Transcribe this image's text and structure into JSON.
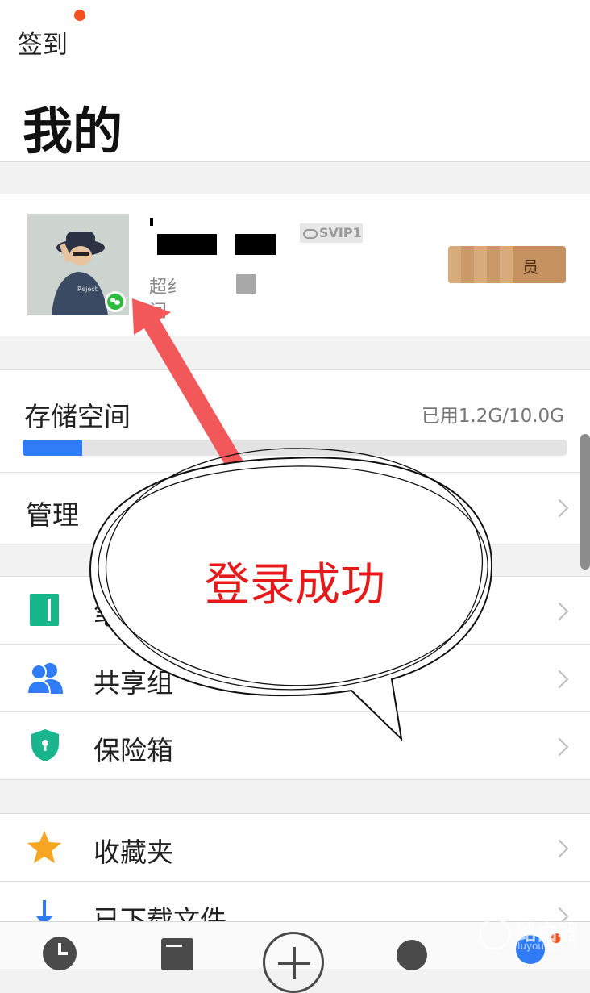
{
  "header": {
    "checkin_label": "签到",
    "title": "我的"
  },
  "profile": {
    "name_redacted": "",
    "vip_badge": "SVIP1",
    "member_button": "员",
    "sub_line1": "超纟",
    "sub_line2": "间"
  },
  "storage": {
    "title": "存储空间",
    "usage": "已用1.2G/10.0G",
    "used_fraction": 0.11,
    "manage_label": "管理"
  },
  "menu1": [
    {
      "label": "笔",
      "icon": "notebook-icon"
    },
    {
      "label": "共享组",
      "icon": "people-icon"
    },
    {
      "label": "保险箱",
      "icon": "shield-icon"
    }
  ],
  "menu2": [
    {
      "label": "收藏夹",
      "icon": "star-icon"
    },
    {
      "label": "已下载文件",
      "icon": "download-arrow-icon"
    }
  ],
  "annotation": {
    "bubble_text": "登录成功"
  },
  "watermark": {
    "text": "路由器",
    "subtext": "luyouqi.com"
  },
  "colors": {
    "accent": "#2f7cf6",
    "annotation_red": "#e6191b",
    "arrow": "#f2575a",
    "notebook_green": "#16b88a",
    "shield_green": "#19b68d",
    "star_orange": "#f6a623"
  }
}
